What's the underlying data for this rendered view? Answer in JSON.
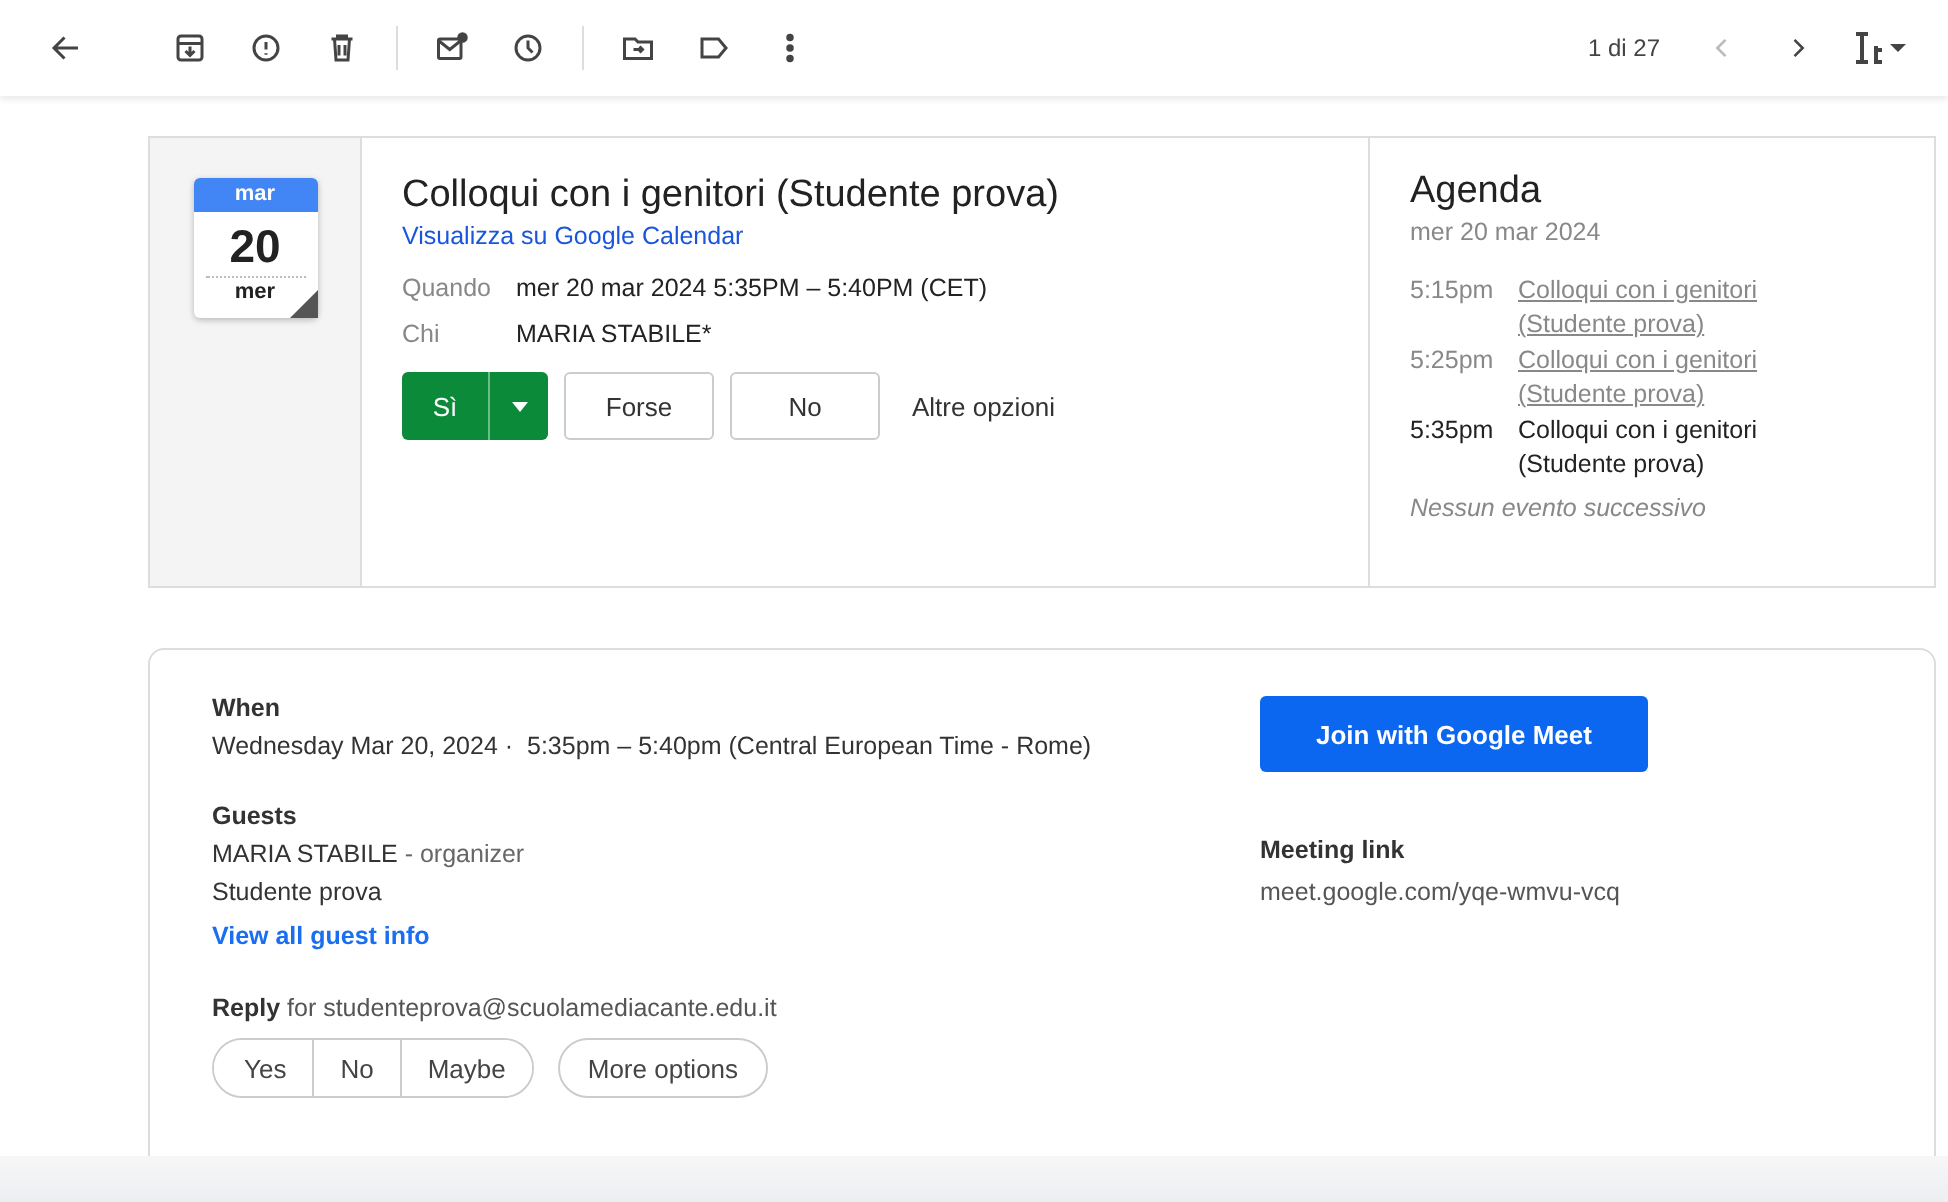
{
  "toolbar": {
    "counter": "1 di 27",
    "prev_disabled": true,
    "next_disabled": false
  },
  "invite": {
    "month": "mar",
    "day": "20",
    "weekday": "mer",
    "title": "Colloqui con i genitori (Studente prova)",
    "calendar_link": "Visualizza su Google Calendar",
    "details": [
      {
        "label": "Quando",
        "value": "mer 20 mar 2024 5:35PM – 5:40PM (CET)"
      },
      {
        "label": "Chi",
        "value": "MARIA STABILE*"
      }
    ],
    "yes": "Sì",
    "maybe": "Forse",
    "no": "No",
    "more": "Altre opzioni"
  },
  "agenda": {
    "title": "Agenda",
    "date": "mer 20 mar 2024",
    "events": [
      {
        "time": "5:15pm",
        "title": "Colloqui con i genitori (Studente prova)",
        "current": false
      },
      {
        "time": "5:25pm",
        "title": "Colloqui con i genitori (Studente prova)",
        "current": false
      },
      {
        "time": "5:35pm",
        "title": "Colloqui con i genitori (Studente prova)",
        "current": true
      }
    ],
    "footer": "Nessun evento successivo"
  },
  "details": {
    "when_label": "When",
    "when_date": "Wednesday Mar 20, 2024",
    "when_separator": "·",
    "when_time": "5:35pm – 5:40pm (Central European Time - Rome)",
    "guests_label": "Guests",
    "guests": [
      {
        "name": "MARIA STABILE",
        "role": "- organizer"
      },
      {
        "name": "Studente prova"
      }
    ],
    "guest_link": "View all guest info",
    "reply": "**Reply** for studenteprova@scuolamediacante.edu.it",
    "reply_buttons": [
      "Yes",
      "No",
      "Maybe"
    ],
    "more_options": "More options",
    "meet_button": "Join with Google Meet",
    "meeting_label": "Meeting link",
    "meeting_link": "meet.google.com/yqe-wmvu-vcq"
  }
}
